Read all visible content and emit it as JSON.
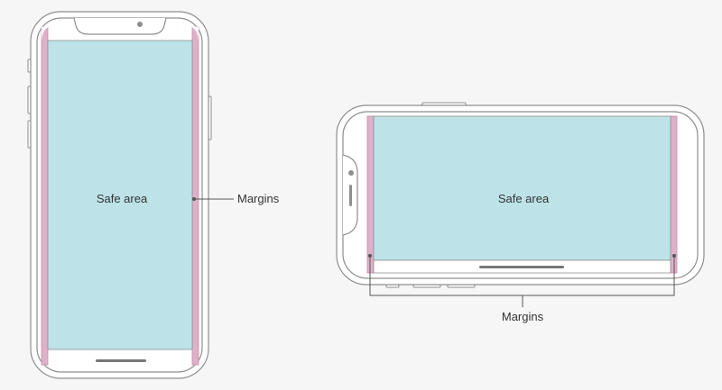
{
  "colors": {
    "background": "#f6f6f6",
    "device_outline": "#8e8e8e",
    "safe_area_fill": "#bde3e8",
    "margin_fill": "#deb1c9",
    "margin_stroke": "#c98aaa",
    "label_text": "#333333",
    "leader_line": "#555555"
  },
  "portrait": {
    "safe_area_label": "Safe area",
    "margins_label": "Margins"
  },
  "landscape": {
    "safe_area_label": "Safe area",
    "margins_label": "Margins"
  }
}
